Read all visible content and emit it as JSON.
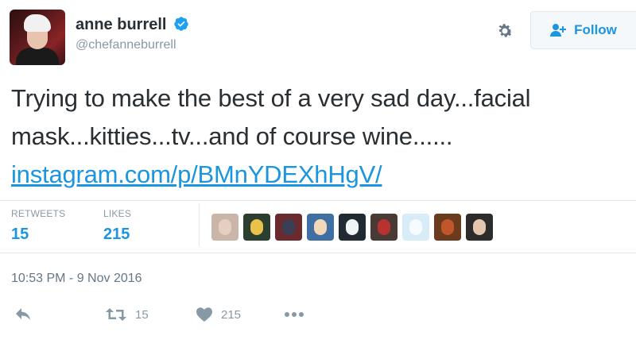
{
  "user": {
    "display_name": "anne burrell",
    "screen_name": "@chefanneburrell",
    "verified": true
  },
  "header": {
    "follow_label": "Follow",
    "gear_icon": "gear-icon",
    "follow_icon": "add-person-icon"
  },
  "tweet": {
    "text": "Trying to make the best of a very sad day...facial mask...kitties...tv...and of course wine......",
    "link": "instagram.com/p/BMnYDEXhHgV/"
  },
  "stats": {
    "retweets_label": "RETWEETS",
    "retweets_value": "15",
    "likes_label": "LIKES",
    "likes_value": "215"
  },
  "likers": [
    {
      "name": "liker-avatar-1",
      "bg": "#c9b6a8",
      "fg": "#e6cfc0"
    },
    {
      "name": "liker-avatar-2",
      "bg": "#2b3e2f",
      "fg": "#e9c24a"
    },
    {
      "name": "liker-avatar-3",
      "bg": "#6b2a2e",
      "fg": "#3a3f55"
    },
    {
      "name": "liker-avatar-4",
      "bg": "#3f6fa3",
      "fg": "#f0d8b8"
    },
    {
      "name": "liker-avatar-5",
      "bg": "#1f2a33",
      "fg": "#eef3f6"
    },
    {
      "name": "liker-avatar-6",
      "bg": "#4a3a36",
      "fg": "#b8322f"
    },
    {
      "name": "liker-avatar-7",
      "bg": "#d7ecf7",
      "fg": "#f5fbff"
    },
    {
      "name": "liker-avatar-8",
      "bg": "#6a3b1c",
      "fg": "#c0562a"
    },
    {
      "name": "liker-avatar-9",
      "bg": "#2c2c2c",
      "fg": "#e2c6b0"
    }
  ],
  "timestamp": "10:53 PM - 9 Nov 2016",
  "actions": {
    "reply_icon": "reply-icon",
    "retweet_icon": "retweet-icon",
    "retweet_count": "15",
    "like_icon": "heart-icon",
    "like_count": "215",
    "more_icon": "more-icon"
  },
  "colors": {
    "accent": "#1b95e0",
    "muted": "#8899a6",
    "text": "#292f33",
    "border": "#e1e8ed"
  }
}
